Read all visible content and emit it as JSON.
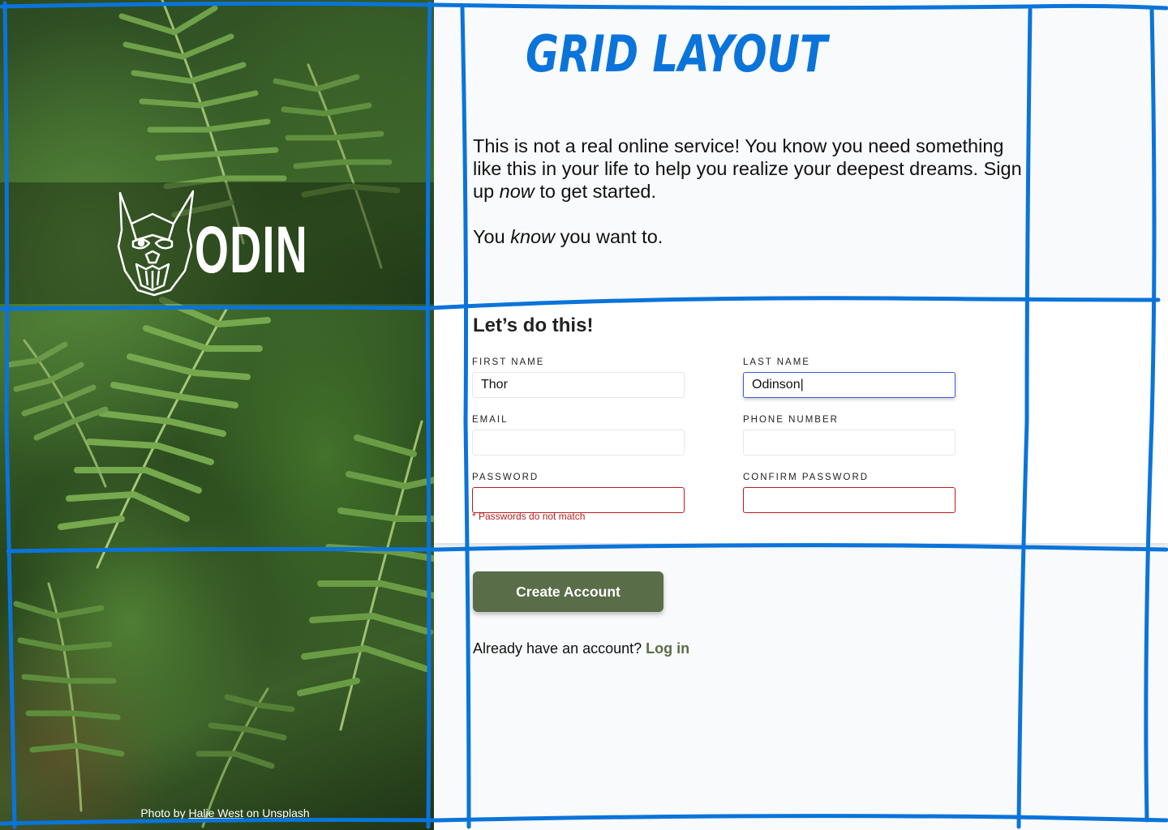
{
  "logo": {
    "text": "ODIN"
  },
  "credit": {
    "prefix": "Photo by",
    "author": "Halie West",
    "middle": "on",
    "site": "Unsplash"
  },
  "annotation": {
    "title": "GRID LAYOUT",
    "line_color": "#0a74da"
  },
  "intro": {
    "line1": "This is not a real online service! You know you need something like this in your life to help you realize your deepest dreams.",
    "line2_pre": "Sign up",
    "line2_em": "now",
    "line2_post": "to get started.",
    "line3_pre": "You",
    "line3_em": "know",
    "line3_post": "you want to."
  },
  "form": {
    "title": "Let’s do this!",
    "first_name": {
      "label": "FIRST NAME",
      "value": "Thor"
    },
    "last_name": {
      "label": "LAST NAME",
      "value": "Odinson|"
    },
    "email": {
      "label": "EMAIL",
      "value": ""
    },
    "phone": {
      "label": "PHONE NUMBER",
      "value": ""
    },
    "password": {
      "label": "PASSWORD",
      "value": ""
    },
    "confirm_password": {
      "label": "CONFIRM PASSWORD",
      "value": ""
    },
    "error": "* Passwords do not match"
  },
  "actions": {
    "create_label": "Create Account",
    "login_prompt": "Already have an account?",
    "login_link": "Log in"
  },
  "colors": {
    "accent": "#596d48",
    "error": "#b91c1c",
    "focus": "#3b5bdb"
  }
}
